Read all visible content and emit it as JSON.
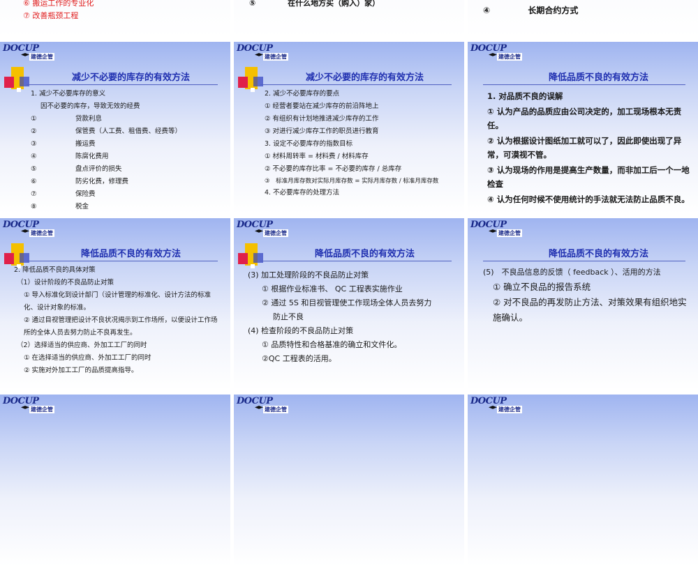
{
  "top_row": {
    "left": [
      "⑥ 搬运工作的专业化",
      "⑦ 改善瓶颈工程"
    ],
    "center": {
      "num": "⑤",
      "text": "在什么地方买（购入）家）"
    },
    "right": {
      "num": "④",
      "text": "长期合约方式"
    }
  },
  "logo": {
    "text": "DOCUP",
    "sub": "建德企管"
  },
  "slide1": {
    "title": "减少不必要的库存的有效方法",
    "heading": "1. 减少不必要库存的意义",
    "intro": "因不必要的库存，导致无效的经费",
    "items": [
      {
        "n": "①",
        "t": "贷款利息"
      },
      {
        "n": "②",
        "t": "保管费（人工费、租借费、经费等）"
      },
      {
        "n": "③",
        "t": "搬运费"
      },
      {
        "n": "④",
        "t": "陈腐化费用"
      },
      {
        "n": "⑤",
        "t": "盘点评价的损失"
      },
      {
        "n": "⑥",
        "t": "防劣化费，修理费"
      },
      {
        "n": "⑦",
        "t": "保险费"
      },
      {
        "n": "⑧",
        "t": "税金"
      }
    ]
  },
  "slide2": {
    "title": "减少不必要的库存的有效方法",
    "lines": [
      "2. 减少不必要库存的要点",
      "① 经营者要站在减少库存的前沿阵地上",
      "② 有组织有计划地推进减少库存的工作",
      "③ 对进行减少库存工作的职员进行教育",
      "3. 设定不必要库存的指数目标",
      "① 材料周转率 = 材料费 / 材料库存",
      "② 不必要的库存比率 = 不必要的库存 / 总库存"
    ],
    "line3": "③　标准月库存数对实际月库存数 = 实际月库存数 / 标准月库存数",
    "line4": "4. 不必要库存的处理方法"
  },
  "slide3": {
    "title": "降低品质不良的有效方法",
    "heading": "1. 对品质不良的误解",
    "items": [
      "① 认为产品的品质应由公司决定的，加工现场根本无责任。",
      "② 认为根据设计图纸加工就可以了，因此即使出现了异常，可漠视不管。",
      "③ 认为现场的作用是提高生产数量，而非加工后一个一地检查",
      "④ 认为任何时候不使用统计的手法就无法防止品质不良。"
    ]
  },
  "slide4": {
    "title": "降低品质不良的有效方法",
    "lines": [
      "2. 降低品质不良的具体对策",
      "（1）设计阶段的不良品防止对策",
      "① 导入标准化到设计部门（设计管理的标准化、设计方法的标准化、设计对象的标准。",
      "② 通过目视管理把设计不良状况揭示到工作场所，以便设计工作场所的全体人员去努力防止不良再发生。",
      "（2）选择适当的供应商、外加工工厂的同时",
      "① 在选择适当的供应商、外加工工厂的同时",
      "② 实施对外加工工厂的品质提高指导。"
    ]
  },
  "slide5": {
    "title": "降低品质不良的有效方法",
    "lines": [
      "(3) 加工处理阶段的不良品防止对策",
      "① 根据作业标准书、 QC 工程表实施作业",
      "② 通过 5S 和目视管理使工作现场全体人员去努力",
      "防止不良",
      "(4) 检查阶段的不良品防止对策",
      "① 品质特性和合格基准的确立和文件化。",
      "②QC 工程表的活用。"
    ]
  },
  "slide6": {
    "title": "降低品质不良的有效方法",
    "lines": [
      "(5)　不良品信息的反馈（ feedback ）、活用的方法",
      "① 确立不良品的报告系统",
      "② 对不良品的再发防止方法、对策效果有组织地实施确认。"
    ]
  }
}
